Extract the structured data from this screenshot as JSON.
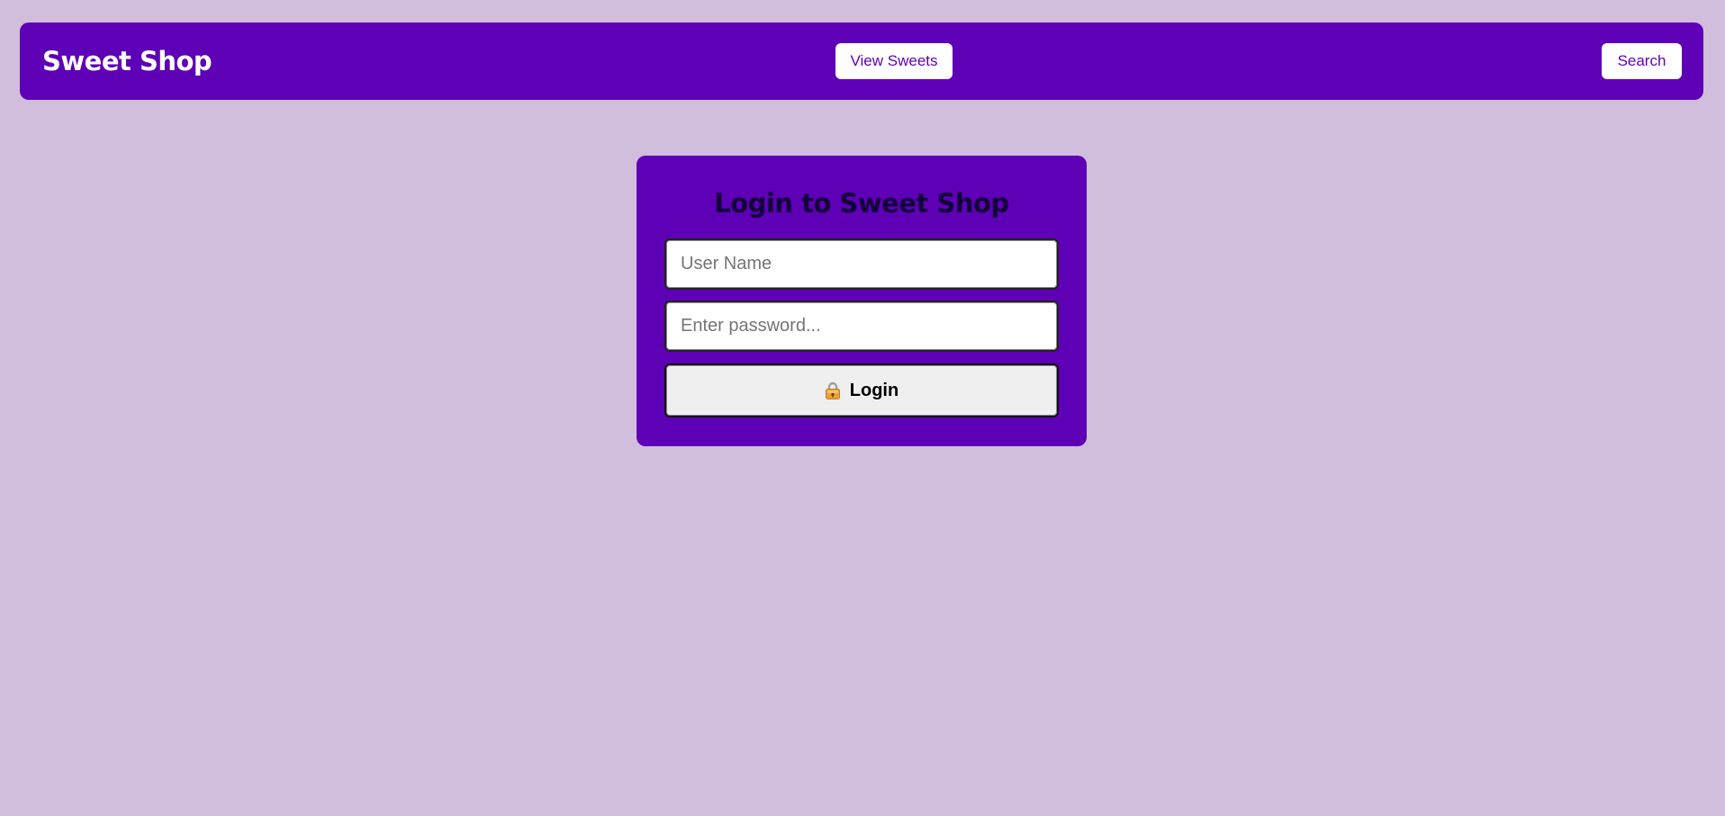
{
  "header": {
    "brand": "Sweet Shop",
    "view_sweets_label": "View Sweets",
    "search_label": "Search"
  },
  "login": {
    "title": "Login to Sweet Shop",
    "username_placeholder": "User Name",
    "password_placeholder": "Enter password...",
    "submit_label": "Login",
    "submit_icon": "lock-icon"
  },
  "colors": {
    "background": "#d1bddc",
    "primary": "#5e00b6",
    "button_bg": "#ffffff",
    "login_button_bg": "#efefef"
  }
}
